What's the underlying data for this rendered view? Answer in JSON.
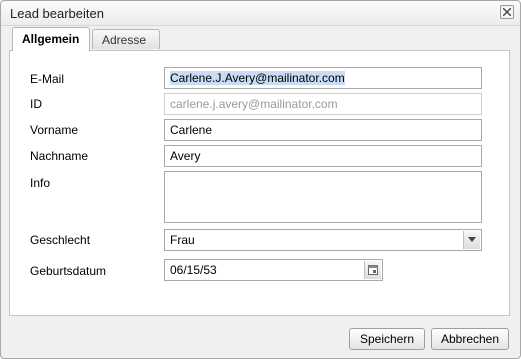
{
  "dialog": {
    "title": "Lead bearbeiten"
  },
  "tabs": [
    {
      "label": "Allgemein",
      "active": true
    },
    {
      "label": "Adresse",
      "active": false
    }
  ],
  "form": {
    "email": {
      "label": "E-Mail",
      "value": "Carlene.J.Avery@mailinator.com"
    },
    "id": {
      "label": "ID",
      "value": "carlene.j.avery@mailinator.com"
    },
    "vorname": {
      "label": "Vorname",
      "value": "Carlene"
    },
    "nachname": {
      "label": "Nachname",
      "value": "Avery"
    },
    "info": {
      "label": "Info",
      "value": ""
    },
    "geschlecht": {
      "label": "Geschlecht",
      "value": "Frau"
    },
    "geburtsdatum": {
      "label": "Geburtsdatum",
      "value": "06/15/53"
    }
  },
  "buttons": {
    "save": "Speichern",
    "cancel": "Abbrechen"
  },
  "icons": {
    "close": "close-icon",
    "dropdown": "chevron-down-icon",
    "calendar": "calendar-icon"
  }
}
